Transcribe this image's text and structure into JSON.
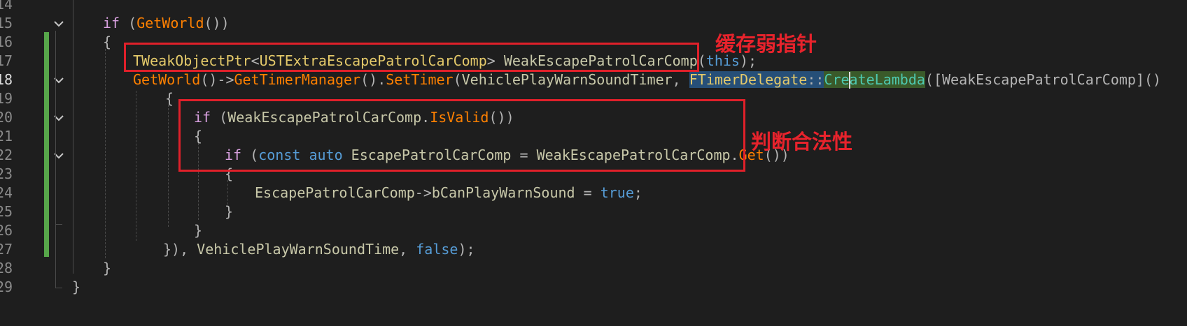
{
  "gutter": {
    "line_numbers": [
      "14",
      "15",
      "16",
      "17",
      "18",
      "19",
      "20",
      "21",
      "22",
      "23",
      "24",
      "25",
      "26",
      "27",
      "28",
      "29"
    ],
    "current_line": "18"
  },
  "code": {
    "l15": {
      "if": "if",
      "p1": " (",
      "getworld": "GetWorld",
      "p2": "())"
    },
    "l16": {
      "brace": "{"
    },
    "l17": {
      "tweak": "TWeakObjectPtr",
      "lt": "<",
      "cls": "USTExtraEscapePatrolCarComp",
      "gt": ">",
      "var": " WeakEscapePatrolCarComp",
      "lp": "(",
      "this": "this",
      "rp": ");"
    },
    "l18": {
      "getworld": "GetWorld",
      "arrow1": "()->",
      "gettm": "GetTimerManager",
      "dot1": "().",
      "settimer": "SetTimer",
      "lp": "(",
      "arg1": "VehiclePlayWarnSoundTimer",
      "comma": ", ",
      "delegate": "FTimerDelegate",
      "scope": "::",
      "create": "CreateLambda",
      "rest": "([WeakEscapePatrolCarComp]()"
    },
    "l19": {
      "brace": "{"
    },
    "l20": {
      "if": "if",
      "p1": " (",
      "obj": "WeakEscapePatrolCarComp",
      "dot": ".",
      "isvalid": "IsValid",
      "p2": "())"
    },
    "l21": {
      "brace": "{"
    },
    "l22": {
      "if": "if",
      "p1": " (",
      "const": "const",
      "sp1": " ",
      "auto": "auto",
      "var": " EscapePatrolCarComp",
      "eq": " = ",
      "obj": "WeakEscapePatrolCarComp",
      "dot": ".",
      "get": "Get",
      "p2": "())"
    },
    "l23": {
      "brace": "{"
    },
    "l24": {
      "obj": "EscapePatrolCarComp",
      "arrow": "->",
      "member": "bCanPlayWarnSound",
      "eq": " = ",
      "true": "true",
      "semi": ";"
    },
    "l25": {
      "brace": "}"
    },
    "l26": {
      "brace": "}"
    },
    "l27": {
      "close": "}),",
      "arg": " VehiclePlayWarnSoundTime",
      "comma": ", ",
      "false": "false",
      "end": ");"
    },
    "l28": {
      "brace": "}"
    },
    "l29": {
      "brace": "}"
    }
  },
  "annotations": {
    "cache_weak_ptr": "缓存弱指针",
    "check_validity": "判断合法性"
  },
  "colors": {
    "annotation_red": "#e8232c",
    "change_bar_green": "#57a64a",
    "background": "#1e1e1e"
  }
}
